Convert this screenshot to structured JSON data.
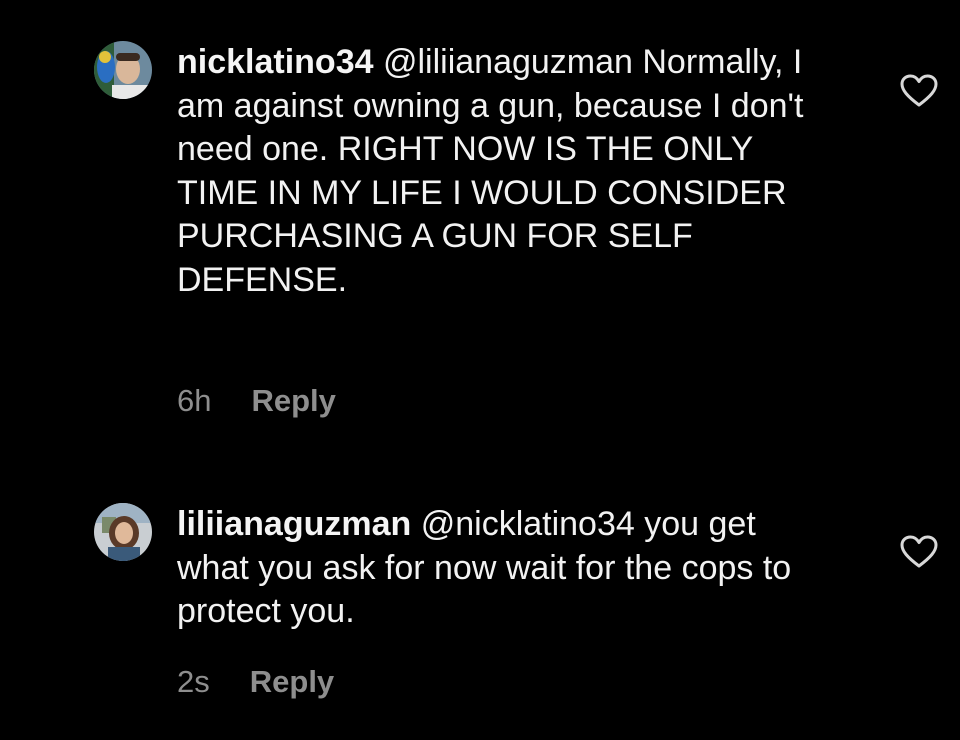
{
  "comments": [
    {
      "username": "nicklatino34",
      "text": " @liliianaguzman Normally, I am against owning a gun, because I don't need one. RIGHT NOW IS THE ONLY TIME IN MY LIFE I WOULD CONSIDER PURCHASING A GUN FOR SELF DEFENSE.",
      "time": "6h",
      "reply_label": "Reply",
      "like_icon": "heart-outline-icon"
    },
    {
      "username": "liliianaguzman",
      "text": " @nicklatino34 you get what you ask for now wait for the cops to protect you.",
      "time": "2s",
      "reply_label": "Reply",
      "like_icon": "heart-outline-icon"
    }
  ],
  "colors": {
    "background": "#000000",
    "text": "#f2f2f2",
    "meta": "#8e8e8e"
  }
}
